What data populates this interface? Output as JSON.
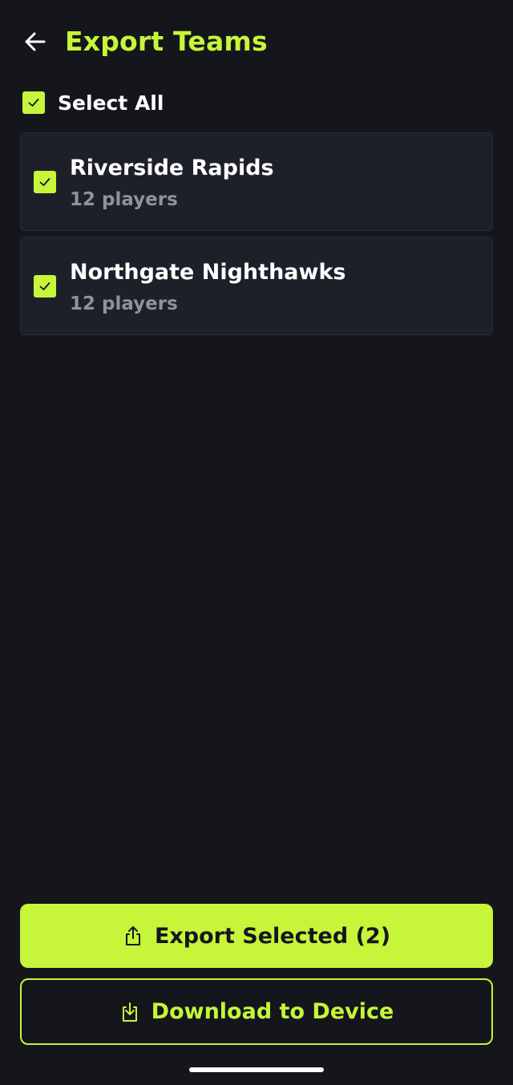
{
  "header": {
    "title": "Export Teams",
    "back_icon": "arrow-left-icon"
  },
  "select_all": {
    "label": "Select All",
    "checked": true
  },
  "teams": [
    {
      "name": "Riverside Rapids",
      "count": "12 players",
      "checked": true
    },
    {
      "name": "Northgate Nighthawks",
      "count": "12 players",
      "checked": true
    }
  ],
  "actions": {
    "export_label": "Export Selected (2)",
    "export_icon": "share-upload-icon",
    "download_label": "Download to Device",
    "download_icon": "download-icon"
  },
  "colors": {
    "background": "#14161b",
    "card": "#1d2028",
    "accent": "#c6f53a",
    "muted_text": "#8e929a"
  }
}
